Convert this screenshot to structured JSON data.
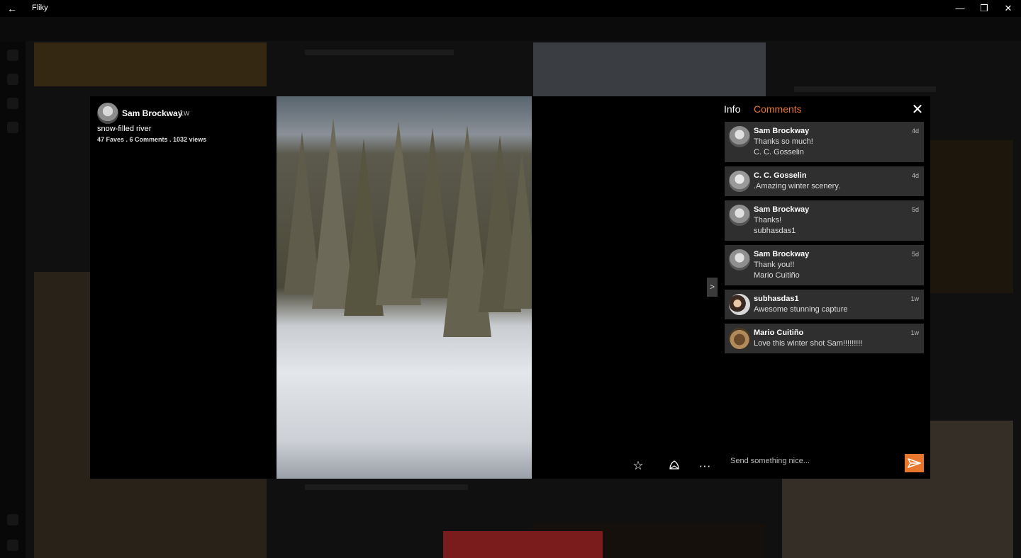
{
  "window": {
    "title": "Fliky",
    "back_icon": "arrow-left-icon",
    "minimize_glyph": "—",
    "restore_glyph": "❐",
    "close_glyph": "✕"
  },
  "photo": {
    "owner_name": "Sam Brockway",
    "posted_ago": "1w",
    "title": "snow-filled river",
    "stats": "47 Faves . 6 Comments . 1032 views"
  },
  "tabs": {
    "info": "Info",
    "comments": "Comments"
  },
  "comments": [
    {
      "author": "Sam Brockway",
      "time": "4d",
      "line1": "Thanks so much!",
      "line2": "C. C. Gosselin"
    },
    {
      "author": "C. C. Gosselin",
      "time": "4d",
      "line1": ".Amazing winter scenery.",
      "line2": ""
    },
    {
      "author": "Sam Brockway",
      "time": "5d",
      "line1": "Thanks!",
      "line2": "subhasdas1"
    },
    {
      "author": "Sam Brockway",
      "time": "5d",
      "line1": "Thank you!!",
      "line2": "Mario Cuitiño"
    },
    {
      "author": "subhasdas1",
      "time": "1w",
      "line1": "Awesome stunning capture",
      "line2": ""
    },
    {
      "author": "Mario Cuitiño",
      "time": "1w",
      "line1": "Love this winter shot Sam!!!!!!!!!",
      "line2": ""
    }
  ],
  "composer": {
    "placeholder": "Send something nice..."
  },
  "actions": {
    "fave_icon": "star-icon",
    "share_icon": "share-icon",
    "more_glyph": "···"
  },
  "colors": {
    "accent": "#e8762d",
    "comment_bg": "#2f2f2f",
    "viewer_bg": "#000000"
  }
}
